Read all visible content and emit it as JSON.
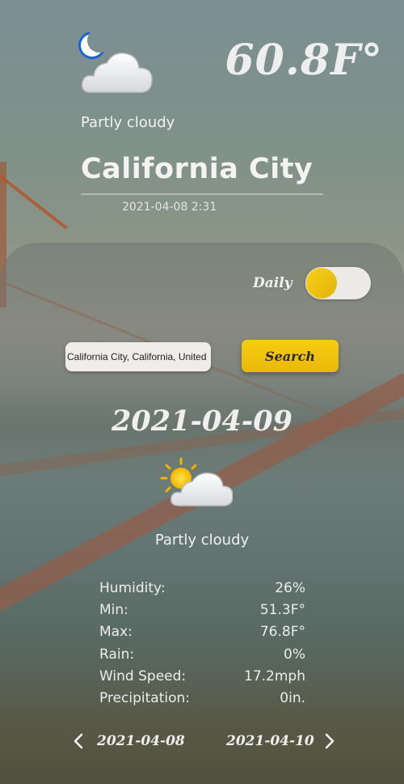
{
  "current": {
    "icon": "moon-cloud-icon",
    "temperature": "60.8F°",
    "condition": "Partly cloudy",
    "city": "California City",
    "datetime": "2021-04-08 2:31"
  },
  "mode": {
    "label": "Daily",
    "toggle_on": false
  },
  "search": {
    "value": "California City, California, United States of America",
    "button_label": "Search"
  },
  "forecast": {
    "date": "2021-04-09",
    "icon": "sun-cloud-icon",
    "condition": "Partly cloudy",
    "stats": [
      {
        "label": "Humidity:",
        "value": "26%"
      },
      {
        "label": "Min:",
        "value": "51.3F°"
      },
      {
        "label": "Max:",
        "value": "76.8F°"
      },
      {
        "label": "Rain:",
        "value": "0%"
      },
      {
        "label": "Wind Speed:",
        "value": "17.2mph"
      },
      {
        "label": "Precipitation:",
        "value": "0in."
      }
    ]
  },
  "nav": {
    "prev_date": "2021-04-08",
    "next_date": "2021-04-10"
  },
  "colors": {
    "accent": "#f2c40f",
    "text": "#f0f0f0"
  }
}
